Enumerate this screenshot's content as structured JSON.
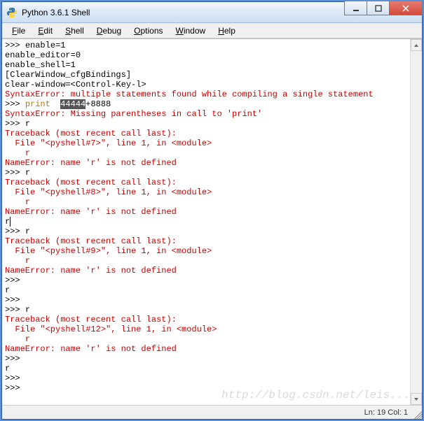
{
  "window": {
    "title": "Python 3.6.1 Shell",
    "icon_name": "python-icon"
  },
  "menubar": {
    "items": [
      {
        "label": "File",
        "accel": "F"
      },
      {
        "label": "Edit",
        "accel": "E"
      },
      {
        "label": "Shell",
        "accel": "S"
      },
      {
        "label": "Debug",
        "accel": "D"
      },
      {
        "label": "Options",
        "accel": "O"
      },
      {
        "label": "Window",
        "accel": "W"
      },
      {
        "label": "Help",
        "accel": "H"
      }
    ]
  },
  "shell_lines": [
    {
      "segments": [
        {
          "t": ">>> ",
          "c": "prompt"
        },
        {
          "t": "enable=1",
          "c": ""
        }
      ]
    },
    {
      "segments": [
        {
          "t": "enable_editor=0",
          "c": ""
        }
      ]
    },
    {
      "segments": [
        {
          "t": "enable_shell=1",
          "c": ""
        }
      ]
    },
    {
      "segments": [
        {
          "t": "[ClearWindow_cfgBindings]",
          "c": ""
        }
      ]
    },
    {
      "segments": [
        {
          "t": "clear-window=<Control-Key-l>",
          "c": ""
        }
      ]
    },
    {
      "segments": [
        {
          "t": "SyntaxError: multiple statements found while compiling a single statement",
          "c": "err"
        }
      ]
    },
    {
      "segments": [
        {
          "t": ">>> ",
          "c": "prompt"
        },
        {
          "t": "print",
          "c": "kw"
        },
        {
          "t": "  ",
          "c": ""
        },
        {
          "t": "44444",
          "c": "sel"
        },
        {
          "t": "+8888",
          "c": ""
        }
      ]
    },
    {
      "segments": [
        {
          "t": "SyntaxError: Missing parentheses in call to 'print'",
          "c": "err"
        }
      ]
    },
    {
      "segments": [
        {
          "t": ">>> ",
          "c": "prompt"
        },
        {
          "t": "r",
          "c": ""
        }
      ]
    },
    {
      "segments": [
        {
          "t": "Traceback (most recent call last):",
          "c": "err"
        }
      ]
    },
    {
      "segments": [
        {
          "t": "  File \"<pyshell#7>\", line 1, in <module>",
          "c": "err"
        }
      ]
    },
    {
      "segments": [
        {
          "t": "    r",
          "c": "err"
        }
      ]
    },
    {
      "segments": [
        {
          "t": "NameError: name 'r' is not defined",
          "c": "err"
        }
      ]
    },
    {
      "segments": [
        {
          "t": ">>> ",
          "c": "prompt"
        },
        {
          "t": "r",
          "c": ""
        }
      ]
    },
    {
      "segments": [
        {
          "t": "Traceback (most recent call last):",
          "c": "err"
        }
      ]
    },
    {
      "segments": [
        {
          "t": "  File \"<pyshell#8>\", line 1, in <module>",
          "c": "err"
        }
      ]
    },
    {
      "segments": [
        {
          "t": "    r",
          "c": "err"
        }
      ]
    },
    {
      "segments": [
        {
          "t": "NameError: name 'r' is not defined",
          "c": "err"
        }
      ]
    },
    {
      "segments": [
        {
          "t": "r",
          "c": ""
        },
        {
          "t": "",
          "c": "cursor"
        }
      ]
    },
    {
      "segments": [
        {
          "t": ">>> ",
          "c": "prompt"
        },
        {
          "t": "r",
          "c": ""
        }
      ]
    },
    {
      "segments": [
        {
          "t": "Traceback (most recent call last):",
          "c": "err"
        }
      ]
    },
    {
      "segments": [
        {
          "t": "  File \"<pyshell#9>\", line 1, in <module>",
          "c": "err"
        }
      ]
    },
    {
      "segments": [
        {
          "t": "    r",
          "c": "err"
        }
      ]
    },
    {
      "segments": [
        {
          "t": "NameError: name 'r' is not defined",
          "c": "err"
        }
      ]
    },
    {
      "segments": [
        {
          "t": ">>> ",
          "c": "prompt"
        }
      ]
    },
    {
      "segments": [
        {
          "t": "r",
          "c": ""
        }
      ]
    },
    {
      "segments": [
        {
          "t": ">>> ",
          "c": "prompt"
        }
      ]
    },
    {
      "segments": [
        {
          "t": ">>> ",
          "c": "prompt"
        },
        {
          "t": "r",
          "c": ""
        }
      ]
    },
    {
      "segments": [
        {
          "t": "Traceback (most recent call last):",
          "c": "err"
        }
      ]
    },
    {
      "segments": [
        {
          "t": "  File \"<pyshell#12>\", line 1, in <module>",
          "c": "err"
        }
      ]
    },
    {
      "segments": [
        {
          "t": "    r",
          "c": "err"
        }
      ]
    },
    {
      "segments": [
        {
          "t": "NameError: name 'r' is not defined",
          "c": "err"
        }
      ]
    },
    {
      "segments": [
        {
          "t": ">>> ",
          "c": "prompt"
        }
      ]
    },
    {
      "segments": [
        {
          "t": "r",
          "c": ""
        }
      ]
    },
    {
      "segments": [
        {
          "t": ">>> ",
          "c": "prompt"
        }
      ]
    },
    {
      "segments": [
        {
          "t": ">>> ",
          "c": "prompt"
        }
      ]
    }
  ],
  "statusbar": {
    "text": "Ln: 19  Col: 1"
  },
  "watermark": "http://blog.csdn.net/leis..."
}
